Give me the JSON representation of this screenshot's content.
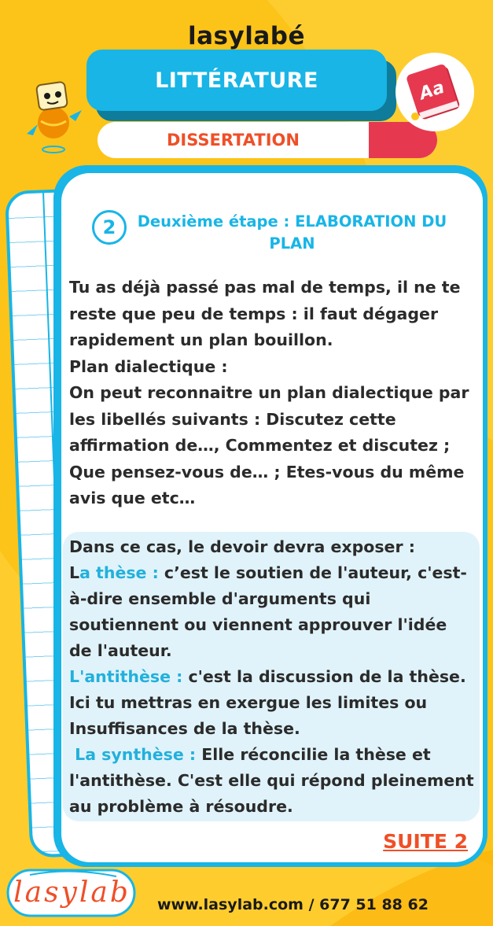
{
  "brand": "lasylabé",
  "subject": "LITTÉRATURE",
  "subtopic": "DISSERTATION",
  "book_icon_label": "Aa",
  "step": {
    "number": "2",
    "title": "Deuxième étape : ELABORATION DU PLAN"
  },
  "body_lines": [
    "Tu as déjà passé pas mal de temps, il ne te reste que peu de  temps : il faut dégager rapidement un plan bouillon.",
    "Plan dialectique :",
    "On peut reconnaitre un plan dialectique par les libellés suivants : Discutez cette affirmation de…, Commentez et discutez ; Que pensez-vous de… ; Etes-vous du même avis que etc…"
  ],
  "highlight": {
    "intro": "Dans ce cas, le devoir  devra exposer :",
    "these_first_letter": "L",
    "these_label": "a thèse :",
    "these_text": " c’est le soutien de l'auteur, c'est-à-dire ensemble d'arguments qui soutiennent ou viennent approuver l'idée de l'auteur.",
    "antithese_label": "L'antithèse :",
    "antithese_text": " c'est la discussion de la thèse. Ici tu mettras en exergue les limites ou Insuffisances de la thèse.",
    "synthese_label": " La synthèse :",
    "synthese_text": " Elle réconcilie la thèse et l'antithèse. C'est elle qui répond pleinement au problème à résoudre."
  },
  "suite_link": "SUITE 2",
  "logo_text": "lasylab",
  "footer_contact": "www.lasylab.com / 677 51 88 62",
  "colors": {
    "background": "#fcc419",
    "accent_blue": "#18b5e6",
    "accent_orange": "#ef4f28",
    "accent_red": "#e63950"
  }
}
